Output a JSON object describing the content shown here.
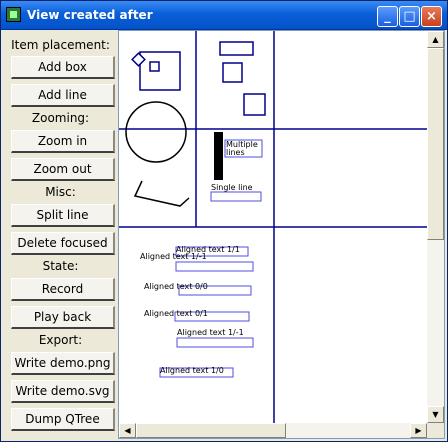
{
  "window": {
    "title": "View created after"
  },
  "titlebar_buttons": {
    "minimize": "_",
    "maximize": "□",
    "close": "×"
  },
  "panel": {
    "item_placement": "Item placement:",
    "add_box": "Add box",
    "add_line": "Add line",
    "zooming": "Zooming:",
    "zoom_in": "Zoom in",
    "zoom_out": "Zoom out",
    "misc": "Misc:",
    "split_line": "Split line",
    "delete_focused": "Delete focused",
    "state": "State:",
    "record": "Record",
    "play_back": "Play back",
    "export": "Export:",
    "write_png": "Write demo.png",
    "write_svg": "Write demo.svg",
    "dump_qtree": "Dump QTree"
  },
  "scene": {
    "multiple_lines": [
      "Multiple",
      "lines"
    ],
    "single_line": "Single line",
    "aligned": [
      "Aligned text 1/1",
      "Aligned text 1/-1",
      "Aligned text 0/0",
      "Aligned text 0/1",
      "Aligned text 1/-1",
      "Aligned text 1/0"
    ]
  },
  "scroll": {
    "up": "▲",
    "down": "▼",
    "left": "◀",
    "right": "▶"
  }
}
